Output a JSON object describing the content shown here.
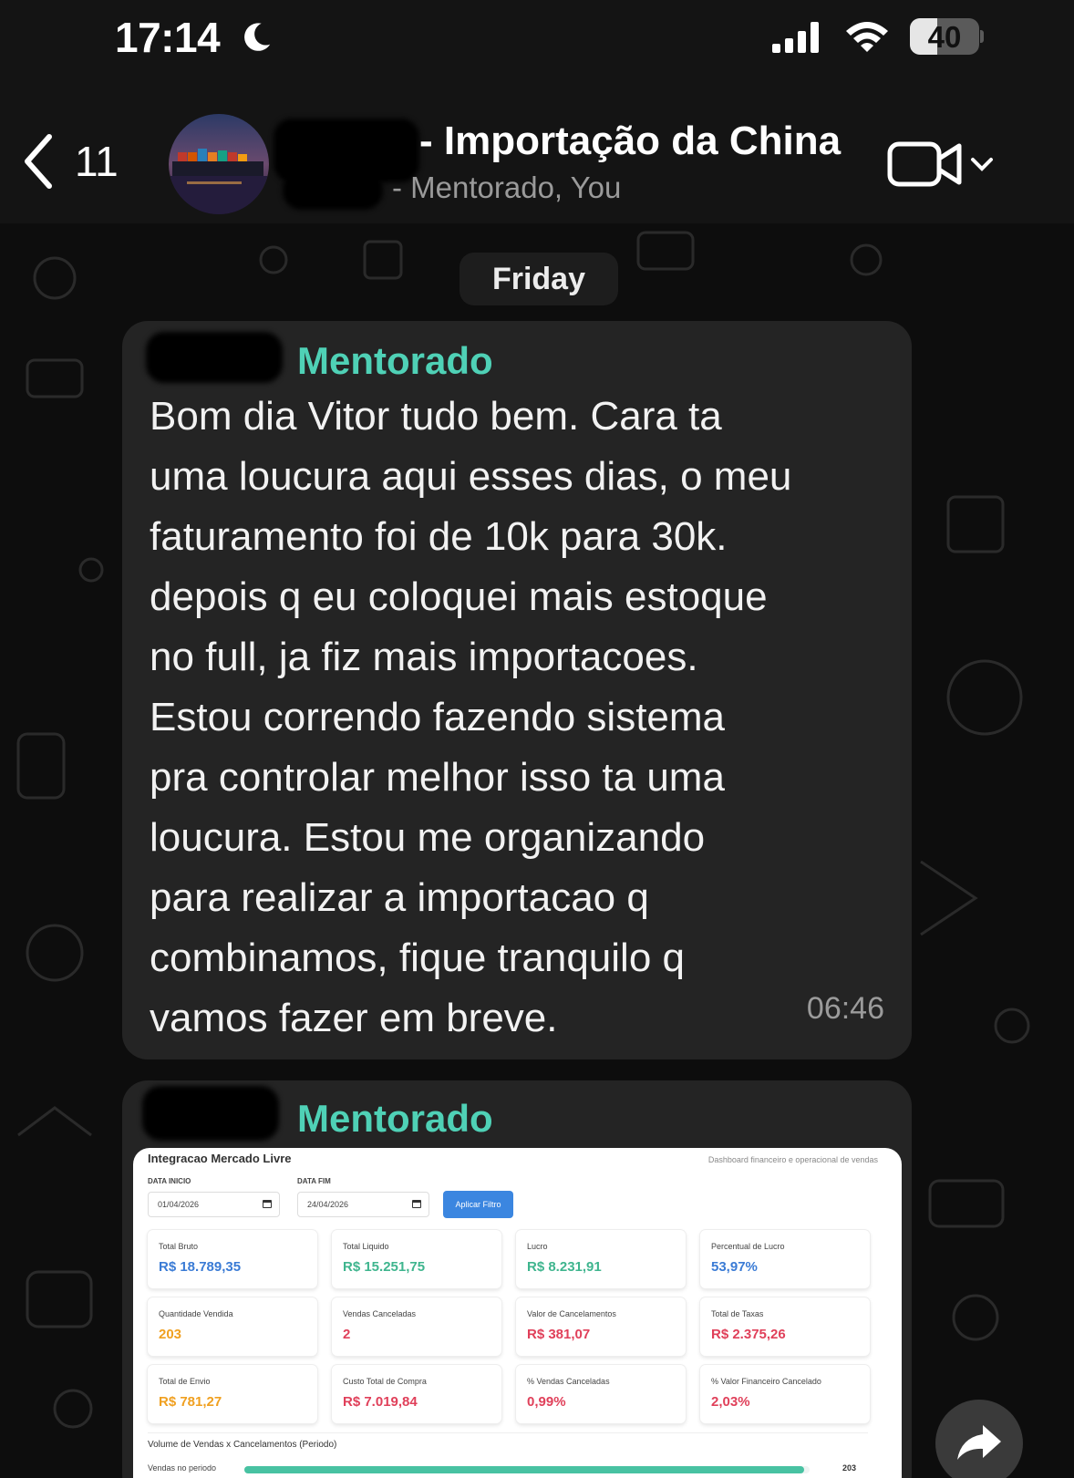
{
  "status_bar": {
    "time": "17:14",
    "battery_percent": 40,
    "battery_label": "40"
  },
  "header": {
    "back_count": "11",
    "group_title": "- Importação da China",
    "group_subtitle": "- Mentorado, You"
  },
  "chat": {
    "date_label": "Friday",
    "messages": [
      {
        "sender": "Mentorado",
        "text": "Bom dia Vitor tudo bem. Cara ta\numa loucura aqui esses dias, o meu\nfaturamento foi de 10k para 30k.\ndepois q eu coloquei mais estoque\nno full, ja fiz mais importacoes.\nEstou correndo fazendo sistema\npra controlar melhor isso ta uma\nloucura. Estou me organizando\npara realizar a importacao q\ncombinamos, fique tranquilo q\nvamos fazer em breve.",
        "time": "06:46"
      },
      {
        "sender": "Mentorado"
      }
    ]
  },
  "dashboard": {
    "title": "Integracao Mercado Livre",
    "subtitle": "Dashboard financeiro e operacional de vendas",
    "start_label": "DATA INICIO",
    "start_value": "01/04/2026",
    "end_label": "DATA FIM",
    "end_value": "24/04/2026",
    "apply_label": "Aplicar Filtro",
    "stats": [
      {
        "label": "Total Bruto",
        "value": "R$ 18.789,35",
        "color": "#3a7bd5"
      },
      {
        "label": "Total Liquido",
        "value": "R$ 15.251,75",
        "color": "#3fb58e"
      },
      {
        "label": "Lucro",
        "value": "R$ 8.231,91",
        "color": "#3fb58e"
      },
      {
        "label": "Percentual de Lucro",
        "value": "53,97%",
        "color": "#3a7bd5"
      },
      {
        "label": "Quantidade Vendida",
        "value": "203",
        "color": "#f0a020"
      },
      {
        "label": "Vendas Canceladas",
        "value": "2",
        "color": "#e0405a"
      },
      {
        "label": "Valor de Cancelamentos",
        "value": "R$ 381,07",
        "color": "#e0405a"
      },
      {
        "label": "Total de Taxas",
        "value": "R$ 2.375,26",
        "color": "#e0405a"
      },
      {
        "label": "Total de Envio",
        "value": "R$ 781,27",
        "color": "#f0a020"
      },
      {
        "label": "Custo Total de Compra",
        "value": "R$ 7.019,84",
        "color": "#e0405a"
      },
      {
        "label": "% Vendas Canceladas",
        "value": "0,99%",
        "color": "#e0405a"
      },
      {
        "label": "% Valor Financeiro Cancelado",
        "value": "2,03%",
        "color": "#e0405a"
      }
    ],
    "volume_title": "Volume de Vendas x Cancelamentos (Periodo)",
    "volume_label": "Vendas no periodo",
    "volume_value": "203",
    "volume_fill_fraction": 0.99
  },
  "colors": {
    "accent_sender": "#4fd1b6",
    "bubble": "#242424",
    "background": "#0d0d0d"
  },
  "icons": [
    "moon-icon",
    "signal-icon",
    "wifi-icon",
    "battery-icon",
    "back-chevron-icon",
    "video-call-icon",
    "chevron-down-icon",
    "share-arrow-icon",
    "calendar-icon"
  ]
}
